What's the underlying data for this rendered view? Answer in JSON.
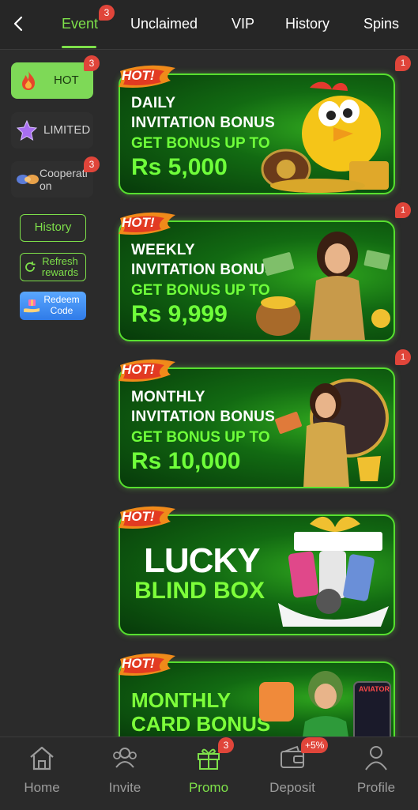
{
  "tabs": [
    {
      "label": "Event",
      "badge": "3"
    },
    {
      "label": "Unclaimed"
    },
    {
      "label": "VIP"
    },
    {
      "label": "History"
    },
    {
      "label": "Spins"
    }
  ],
  "sidebar": {
    "items": [
      {
        "label": "HOT",
        "badge": "3"
      },
      {
        "label": "LIMITED"
      },
      {
        "label": "Cooperation",
        "badge": "3"
      }
    ],
    "history_label": "History",
    "refresh_label": "Refresh rewards",
    "redeem_label": "Redeem Code"
  },
  "banners": [
    {
      "tag": "HOT!",
      "line1": "DAILY",
      "line2": "INVITATION BONUS",
      "line3": "GET BONUS UP TO",
      "amount": "Rs 5,000",
      "badge": "1"
    },
    {
      "tag": "HOT!",
      "line1": "WEEKLY",
      "line2": "INVITATION BONUS",
      "line3": "GET BONUS UP TO",
      "amount": "Rs 9,999",
      "badge": "1"
    },
    {
      "tag": "HOT!",
      "line1": "MONTHLY",
      "line2": "INVITATION BONUS",
      "line3": "GET BONUS UP TO",
      "amount": "Rs 10,000",
      "badge": "1"
    },
    {
      "tag": "HOT!",
      "line1": "LUCKY",
      "line2": "BLIND BOX"
    },
    {
      "tag": "HOT!",
      "line1": "MONTHLY",
      "line2": "CARD BONUS",
      "extra": "AVIATOR"
    }
  ],
  "bottom_nav": [
    {
      "label": "Home",
      "icon": "home-icon"
    },
    {
      "label": "Invite",
      "icon": "invite-icon"
    },
    {
      "label": "Promo",
      "icon": "gift-icon",
      "badge": "3"
    },
    {
      "label": "Deposit",
      "icon": "wallet-icon",
      "badge": "+5%"
    },
    {
      "label": "Profile",
      "icon": "profile-icon"
    }
  ],
  "colors": {
    "accent": "#7ee04a",
    "badge": "#e0453a",
    "background": "#2b2b2b"
  }
}
